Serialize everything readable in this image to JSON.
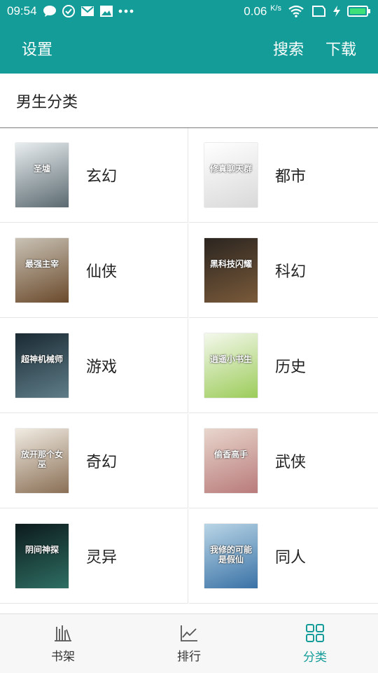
{
  "status_bar": {
    "time": "09:54",
    "speed": "0.06",
    "speed_unit": "K/s",
    "icons_left": [
      "chat-icon",
      "check-circle-icon",
      "mail-icon",
      "image-icon",
      "more-dots-icon"
    ],
    "icons_right": [
      "wifi-icon",
      "sim-icon",
      "charging-icon",
      "battery-icon"
    ]
  },
  "app_bar": {
    "settings_label": "设置",
    "search_label": "搜索",
    "download_label": "下载"
  },
  "section": {
    "title": "男生分类"
  },
  "categories": [
    {
      "label": "玄幻",
      "cover_title": "圣墟",
      "cover_colors": [
        "#e9eef0",
        "#5b6a70"
      ]
    },
    {
      "label": "都市",
      "cover_title": "修真聊天群",
      "cover_colors": [
        "#ffffff",
        "#d9d9d9"
      ]
    },
    {
      "label": "仙侠",
      "cover_title": "最强主宰",
      "cover_colors": [
        "#c9c2b5",
        "#6b4a2c"
      ]
    },
    {
      "label": "科幻",
      "cover_title": "黑科技闪耀",
      "cover_colors": [
        "#2b2520",
        "#7a5a3a"
      ]
    },
    {
      "label": "游戏",
      "cover_title": "超神机械师",
      "cover_colors": [
        "#1a2a33",
        "#5f7d88"
      ]
    },
    {
      "label": "历史",
      "cover_title": "逍遥小书生",
      "cover_colors": [
        "#f4f8ec",
        "#9ccc5a"
      ]
    },
    {
      "label": "奇幻",
      "cover_title": "放开那个女巫",
      "cover_colors": [
        "#f1ece3",
        "#8a6f55"
      ]
    },
    {
      "label": "武侠",
      "cover_title": "偷香高手",
      "cover_colors": [
        "#e8d6cc",
        "#b97b7b"
      ]
    },
    {
      "label": "灵异",
      "cover_title": "阴间神探",
      "cover_colors": [
        "#0c1a1c",
        "#2e6e62"
      ]
    },
    {
      "label": "同人",
      "cover_title": "我修的可能是假仙",
      "cover_colors": [
        "#b9d5e6",
        "#3a72a6"
      ]
    }
  ],
  "bottom_nav": [
    {
      "label": "书架",
      "icon": "bookshelf-icon",
      "active": false
    },
    {
      "label": "排行",
      "icon": "ranking-chart-icon",
      "active": false
    },
    {
      "label": "分类",
      "icon": "category-grid-icon",
      "active": true
    }
  ],
  "colors": {
    "primary": "#149c98",
    "active_nav": "#149c98"
  }
}
